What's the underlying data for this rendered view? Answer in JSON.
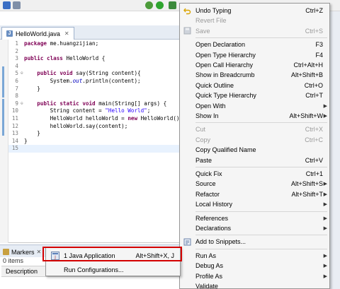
{
  "editor": {
    "tab_title": "HelloWorld.java",
    "code_lines": [
      {
        "n": "1",
        "parts": [
          [
            "kw",
            "package"
          ],
          [
            "txt",
            " me.huangzijian;"
          ]
        ]
      },
      {
        "n": "2",
        "parts": []
      },
      {
        "n": "3",
        "parts": [
          [
            "kw",
            "public"
          ],
          [
            "txt",
            " "
          ],
          [
            "kw",
            "class"
          ],
          [
            "txt",
            " HelloWorld {"
          ]
        ]
      },
      {
        "n": "4",
        "parts": []
      },
      {
        "n": "5",
        "fold": true,
        "parts": [
          [
            "txt",
            "    "
          ],
          [
            "kw",
            "public"
          ],
          [
            "txt",
            " "
          ],
          [
            "kw",
            "void"
          ],
          [
            "txt",
            " say(String content){"
          ]
        ]
      },
      {
        "n": "6",
        "parts": [
          [
            "txt",
            "        System."
          ],
          [
            "fld",
            "out"
          ],
          [
            "txt",
            ".println(content);"
          ]
        ]
      },
      {
        "n": "7",
        "parts": [
          [
            "txt",
            "    }"
          ]
        ]
      },
      {
        "n": "8",
        "parts": []
      },
      {
        "n": "9",
        "fold": true,
        "parts": [
          [
            "txt",
            "    "
          ],
          [
            "kw",
            "public"
          ],
          [
            "txt",
            " "
          ],
          [
            "kw",
            "static"
          ],
          [
            "txt",
            " "
          ],
          [
            "kw",
            "void"
          ],
          [
            "txt",
            " main(String[] args) {"
          ]
        ]
      },
      {
        "n": "10",
        "parts": [
          [
            "txt",
            "        String content = "
          ],
          [
            "str",
            "\"Hello World\""
          ],
          [
            "txt",
            ";"
          ]
        ]
      },
      {
        "n": "11",
        "parts": [
          [
            "txt",
            "        HelloWorld helloWorld = "
          ],
          [
            "kw",
            "new"
          ],
          [
            "txt",
            " HelloWorld();"
          ]
        ]
      },
      {
        "n": "12",
        "parts": [
          [
            "txt",
            "        helloWorld.say(content);"
          ]
        ]
      },
      {
        "n": "13",
        "parts": [
          [
            "txt",
            "    }"
          ]
        ]
      },
      {
        "n": "14",
        "parts": [
          [
            "txt",
            "}"
          ]
        ]
      },
      {
        "n": "15",
        "cursor": true,
        "parts": [
          [
            "txt",
            "    "
          ]
        ]
      }
    ]
  },
  "markers_panel": {
    "tab_label": "Markers",
    "items_count": "0 items",
    "column_header": "Description"
  },
  "run_as_submenu": {
    "items": [
      {
        "label": "1 Java Application",
        "shortcut": "Alt+Shift+X, J",
        "icon": "java-application-icon"
      },
      {
        "label": "Run Configurations...",
        "shortcut": "",
        "icon": ""
      }
    ]
  },
  "context_menu": {
    "items": [
      {
        "type": "item",
        "label": "Undo Typing",
        "shortcut": "Ctrl+Z",
        "icon": "undo-icon"
      },
      {
        "type": "item",
        "label": "Revert File",
        "shortcut": "",
        "disabled": true
      },
      {
        "type": "item",
        "label": "Save",
        "shortcut": "Ctrl+S",
        "disabled": true,
        "icon": "save-icon"
      },
      {
        "type": "sep"
      },
      {
        "type": "item",
        "label": "Open Declaration",
        "shortcut": "F3"
      },
      {
        "type": "item",
        "label": "Open Type Hierarchy",
        "shortcut": "F4"
      },
      {
        "type": "item",
        "label": "Open Call Hierarchy",
        "shortcut": "Ctrl+Alt+H"
      },
      {
        "type": "item",
        "label": "Show in Breadcrumb",
        "shortcut": "Alt+Shift+B"
      },
      {
        "type": "item",
        "label": "Quick Outline",
        "shortcut": "Ctrl+O"
      },
      {
        "type": "item",
        "label": "Quick Type Hierarchy",
        "shortcut": "Ctrl+T"
      },
      {
        "type": "item",
        "label": "Open With",
        "shortcut": "",
        "submenu": true
      },
      {
        "type": "item",
        "label": "Show In",
        "shortcut": "Alt+Shift+W",
        "submenu": true
      },
      {
        "type": "sep"
      },
      {
        "type": "item",
        "label": "Cut",
        "shortcut": "Ctrl+X",
        "disabled": true
      },
      {
        "type": "item",
        "label": "Copy",
        "shortcut": "Ctrl+C",
        "disabled": true
      },
      {
        "type": "item",
        "label": "Copy Qualified Name",
        "shortcut": ""
      },
      {
        "type": "item",
        "label": "Paste",
        "shortcut": "Ctrl+V"
      },
      {
        "type": "sep"
      },
      {
        "type": "item",
        "label": "Quick Fix",
        "shortcut": "Ctrl+1"
      },
      {
        "type": "item",
        "label": "Source",
        "shortcut": "Alt+Shift+S",
        "submenu": true
      },
      {
        "type": "item",
        "label": "Refactor",
        "shortcut": "Alt+Shift+T",
        "submenu": true
      },
      {
        "type": "item",
        "label": "Local History",
        "shortcut": "",
        "submenu": true
      },
      {
        "type": "sep"
      },
      {
        "type": "item",
        "label": "References",
        "shortcut": "",
        "submenu": true
      },
      {
        "type": "item",
        "label": "Declarations",
        "shortcut": "",
        "submenu": true
      },
      {
        "type": "sep"
      },
      {
        "type": "item",
        "label": "Add to Snippets...",
        "shortcut": "",
        "icon": "snippet-icon"
      },
      {
        "type": "sep"
      },
      {
        "type": "item",
        "label": "Run As",
        "shortcut": "",
        "submenu": true
      },
      {
        "type": "item",
        "label": "Debug As",
        "shortcut": "",
        "submenu": true
      },
      {
        "type": "item",
        "label": "Profile As",
        "shortcut": "",
        "submenu": true
      },
      {
        "type": "item",
        "label": "Validate",
        "shortcut": ""
      }
    ]
  },
  "colors": {
    "keyword": "#7f0055",
    "string": "#2a00ff",
    "static_field": "#0000c0",
    "highlight_border": "#d40000"
  }
}
